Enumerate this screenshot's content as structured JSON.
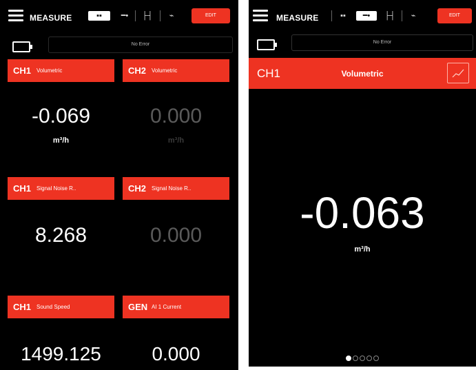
{
  "header": {
    "title": "MEASURE",
    "edit_label": "EDIT"
  },
  "status": {
    "message": "No Error"
  },
  "left_screen": {
    "tiles": [
      {
        "ch": "CH1",
        "name": "Volumetric",
        "value": "-0.069",
        "unit": "m³/h",
        "dim": false
      },
      {
        "ch": "CH2",
        "name": "Volumetric",
        "value": "0.000",
        "unit": "m³/h",
        "dim": true
      },
      {
        "ch": "CH1",
        "name": "Signal Noise R..",
        "value": "8.268",
        "unit": "",
        "dim": false
      },
      {
        "ch": "CH2",
        "name": "Signal Noise R..",
        "value": "0.000",
        "unit": "",
        "dim": true
      },
      {
        "ch": "CH1",
        "name": "Sound Speed",
        "value": "1499.125",
        "unit": "",
        "dim": false
      },
      {
        "ch": "GEN",
        "name": "AI 1 Current",
        "value": "0.000",
        "unit": "",
        "dim": false
      }
    ]
  },
  "right_screen": {
    "ch": "CH1",
    "name": "Volumetric",
    "value": "-0.063",
    "unit": "m³/h",
    "page_index": 1,
    "page_count": 5
  },
  "colors": {
    "accent": "#ee3322",
    "background": "#000000",
    "dim_text": "#5a5a5a"
  },
  "icons": {
    "menu": "hamburger-icon",
    "views": [
      "grid-view-icon",
      "single-view-icon",
      "range-view-icon",
      "trend-view-icon"
    ],
    "battery": "battery-icon",
    "trend": "trend-chart-icon"
  }
}
